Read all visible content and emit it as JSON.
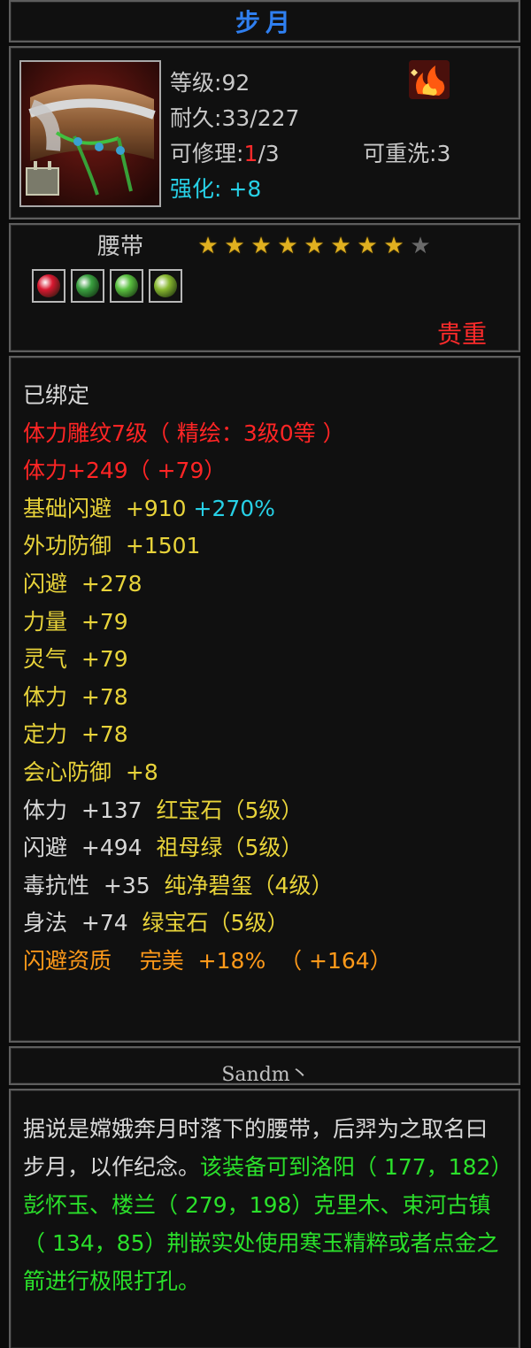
{
  "title": "步月",
  "info": {
    "level_label": "等级",
    "level": "92",
    "durability_label": "耐久",
    "durability": "33/227",
    "repair_label": "可修理",
    "repair_used": "1",
    "repair_total": "/3",
    "rewash_label": "可重洗",
    "rewash": "3",
    "enhance_label": "强化",
    "enhance": "+8"
  },
  "item_name": "腰带",
  "stars": {
    "filled": 8,
    "total": 9
  },
  "gems": [
    {
      "name": "ruby-gem",
      "color": "#d81830"
    },
    {
      "name": "emerald-gem",
      "color": "#3aa040"
    },
    {
      "name": "green-gem",
      "color": "#5ac040"
    },
    {
      "name": "jade-gem",
      "color": "#88b830"
    }
  ],
  "rarity": "贵重",
  "attributes": [
    {
      "color": "white",
      "parts": [
        "已绑定"
      ]
    },
    {
      "color": "red",
      "parts": [
        "体力雕纹7级（ 精绘：3级0等 ）"
      ]
    },
    {
      "color": "red",
      "parts": [
        "体力+249（ +79）"
      ]
    },
    {
      "color": "yellow",
      "parts": [
        "基础闪避  +910 "
      ],
      "extra": "+270%"
    },
    {
      "color": "yellow",
      "parts": [
        "外功防御  +1501"
      ]
    },
    {
      "color": "yellow",
      "parts": [
        "闪避  +278"
      ]
    },
    {
      "color": "yellow",
      "parts": [
        "力量  +79"
      ]
    },
    {
      "color": "yellow",
      "parts": [
        "灵气  +79"
      ]
    },
    {
      "color": "yellow",
      "parts": [
        "体力  +78"
      ]
    },
    {
      "color": "yellow",
      "parts": [
        "定力  +78"
      ]
    },
    {
      "color": "yellow",
      "parts": [
        "会心防御  +8"
      ]
    },
    {
      "color": "white",
      "parts": [
        "体力  +137  "
      ],
      "gem": "红宝石（5级）"
    },
    {
      "color": "white",
      "parts": [
        "闪避  +494  "
      ],
      "gem": "祖母绿（5级）"
    },
    {
      "color": "white",
      "parts": [
        "毒抗性  +35  "
      ],
      "gem": "纯净碧玺（4级）"
    },
    {
      "color": "white",
      "parts": [
        "身法  +74  "
      ],
      "gem": "绿宝石（5级）"
    },
    {
      "color": "orange",
      "parts": [
        "闪避资质    完美  +18%  （ +164）"
      ]
    }
  ],
  "maker": "Sandm丶",
  "description": {
    "lore": "据说是嫦娥奔月时落下的腰带，后羿为之取名曰步月，以作纪念。",
    "hint": "该装备可到洛阳（ 177，182）彭怀玉、楼兰（ 279，198）克里木、束河古镇（ 134，85）荆嵌实处使用寒玉精粹或者点金之箭进行极限打孔。"
  }
}
